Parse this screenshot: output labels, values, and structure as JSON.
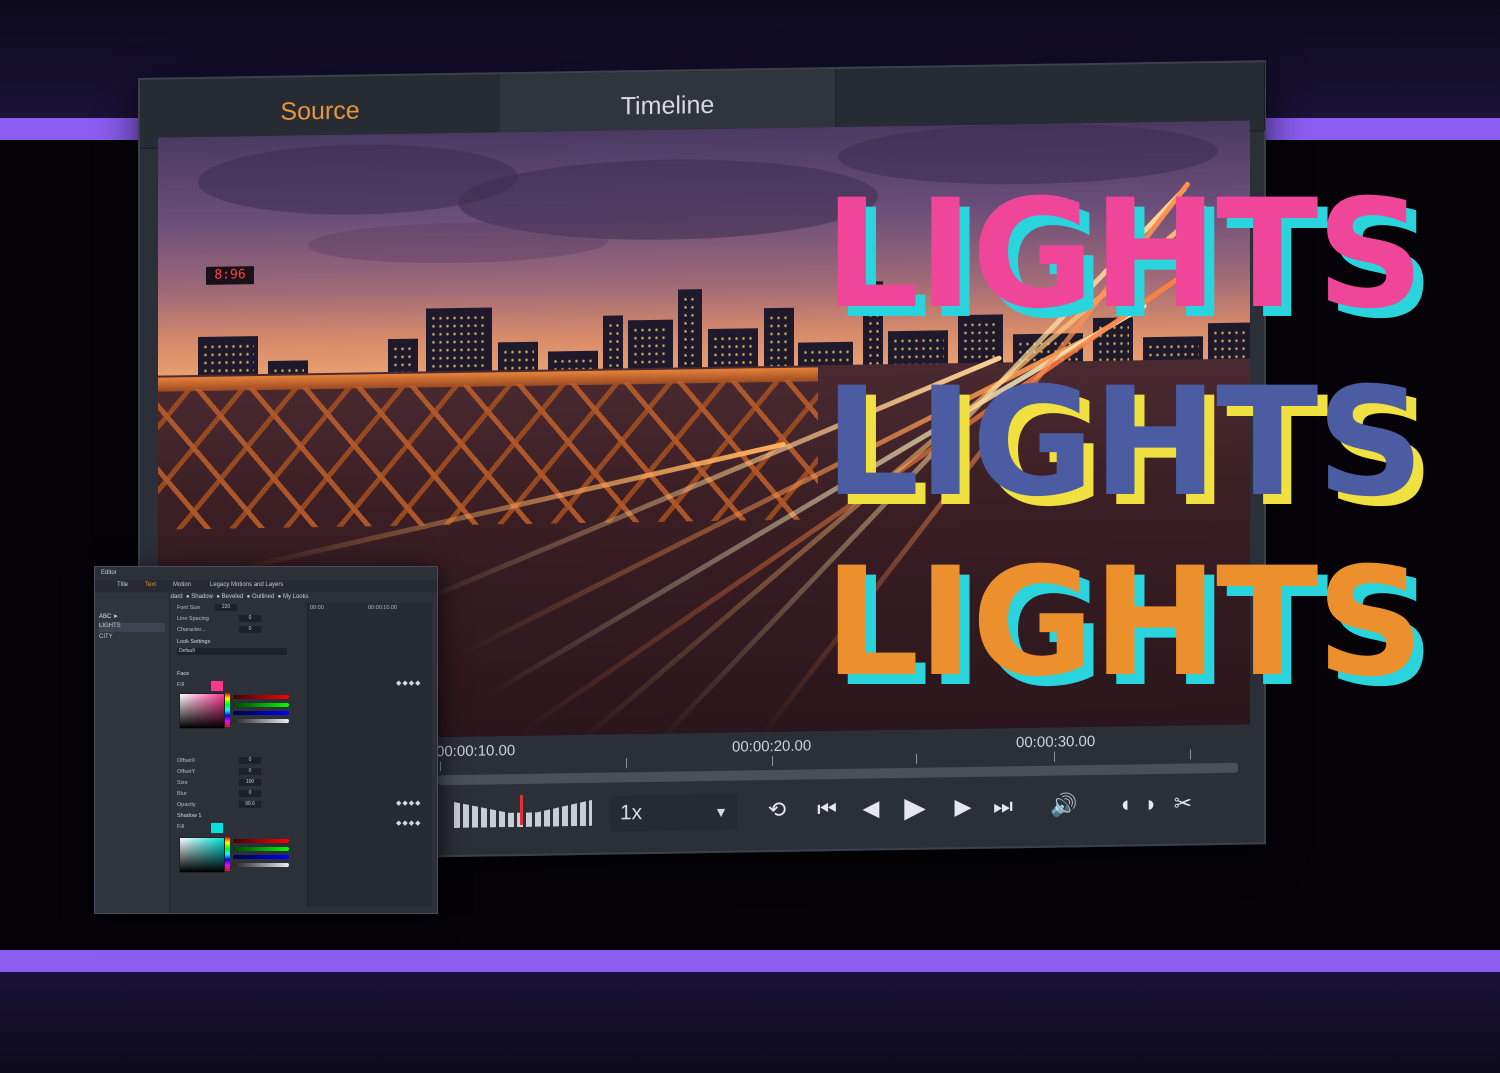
{
  "player": {
    "tabs": [
      {
        "label": "Source"
      },
      {
        "label": "Timeline"
      }
    ],
    "ruler": {
      "timecodes": [
        "00:00:10.00",
        "00:00:20.00",
        "00:00:30.00"
      ]
    },
    "speed": {
      "value": "1x"
    },
    "clock_display": "8:96",
    "controls": [
      "loop-icon",
      "go-to-start-icon",
      "previous-frame-icon",
      "play-icon",
      "next-frame-icon",
      "go-to-end-icon",
      "volume-icon",
      "mark-in-icon",
      "mark-out-icon",
      "split-icon"
    ]
  },
  "overlay_text": {
    "lines": [
      {
        "text": "LIGHTS",
        "color": "#f0469a",
        "shadow": "#2ad4dc"
      },
      {
        "text": "LIGHTS",
        "color": "#4b5ca2",
        "shadow": "#f0e040"
      },
      {
        "text": "LIGHTS",
        "color": "#eb902c",
        "shadow": "#2ad4dc"
      }
    ]
  },
  "editor": {
    "title": "Editor",
    "tabs": [
      "Title",
      "Text",
      "Motion",
      "Legacy Motions and Layers"
    ],
    "active_tab": "Text",
    "looks": [
      "Standard",
      "Shadow",
      "Beveled",
      "Outlined",
      "My Looks"
    ],
    "layers": [
      {
        "label": "LIGHTS"
      },
      {
        "label": "CITY"
      }
    ],
    "props": {
      "font_size_label": "Font Size",
      "font_size_value": "220",
      "line_spacing_label": "Line Spacing",
      "line_spacing_value": "0",
      "character_label": "Character...",
      "character_value": "0",
      "look_settings_label": "Look Settings",
      "look_default": "Default",
      "face_label": "Face",
      "fill_label": "Fill",
      "offset_x_label": "OffsetX",
      "offset_x_value": "0",
      "offset_y_label": "OffsetY",
      "offset_y_value": "0",
      "size_label": "Size",
      "size_value": "100",
      "blur_label": "Blur",
      "blur_value": "0",
      "opacity_label": "Opacity",
      "opacity_value": "99.6",
      "shadow1_label": "Shadow 1",
      "face_rgb": [
        "255",
        "54",
        "142",
        "0.99"
      ],
      "shadow_rgb": [
        "0",
        "226",
        "222",
        "0.99"
      ]
    },
    "timeline_marks": [
      "00:00",
      "00:00:10.00"
    ]
  },
  "colors": {
    "accent_orange": "#e8953a",
    "stripe_purple": "#8b5cf0",
    "panel_bg": "#2b2f38"
  }
}
